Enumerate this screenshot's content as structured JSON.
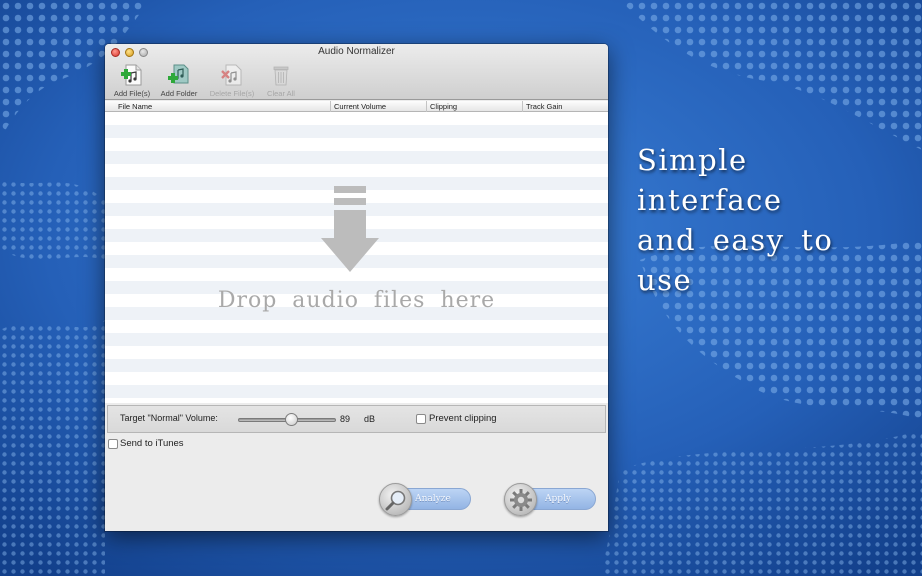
{
  "window": {
    "title": "Audio Normalizer"
  },
  "toolbar": {
    "add_files": "Add File(s)",
    "add_folder": "Add Folder",
    "delete_files": "Delete File(s)",
    "clear_all": "Clear All"
  },
  "columns": [
    "File Name",
    "Current Volume",
    "Clipping",
    "Track Gain"
  ],
  "drop_area": {
    "text": "Drop audio files here",
    "icon": "down-arrow-icon"
  },
  "settings": {
    "target_label": "Target \"Normal\" Volume:",
    "volume_value": "89",
    "volume_unit": "dB",
    "slider_fraction": 0.55,
    "prevent_clipping_label": "Prevent clipping",
    "prevent_clipping_checked": false,
    "send_itunes_label": "Send to iTunes",
    "send_itunes_checked": false
  },
  "actions": {
    "analyze": "Analyze",
    "apply": "Apply"
  },
  "promo": {
    "line1": "Simple interface",
    "line2": "and easy to",
    "line3": "use"
  },
  "colors": {
    "background": "#1d5bb0",
    "accent_button": "#a8c3ec",
    "add_icon": "#2ea83a"
  }
}
